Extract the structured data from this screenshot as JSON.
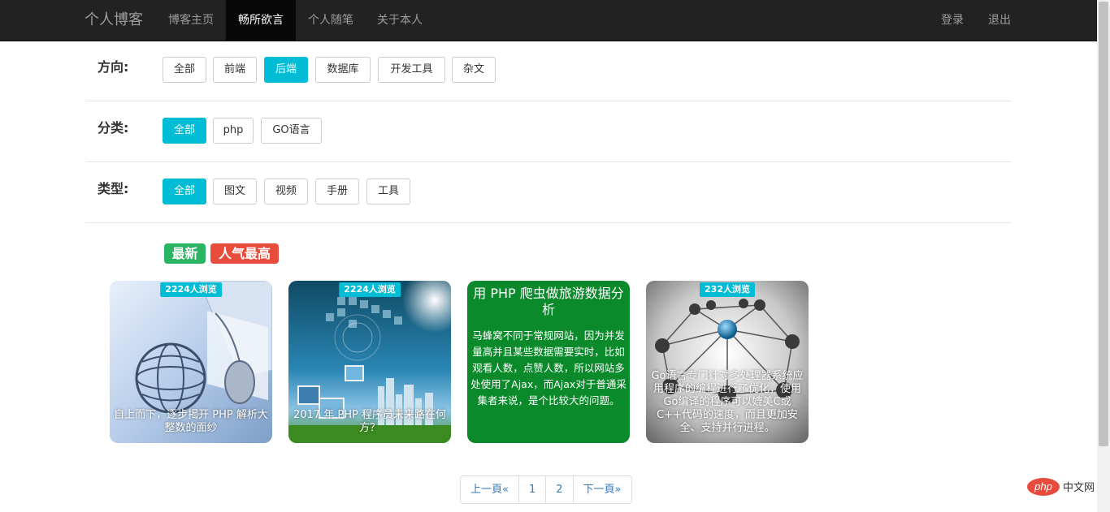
{
  "navbar": {
    "brand": "个人博客",
    "items": [
      "博客主页",
      "畅所欲言",
      "个人随笔",
      "关于本人"
    ],
    "active": "畅所欲言",
    "right": [
      "登录",
      "退出"
    ]
  },
  "filters": {
    "direction": {
      "label": "方向:",
      "options": [
        "全部",
        "前端",
        "后端",
        "数据库",
        "开发工具",
        "杂文"
      ],
      "selected": "后端"
    },
    "category": {
      "label": "分类:",
      "options": [
        "全部",
        "php",
        "GO语言"
      ],
      "selected": "全部"
    },
    "type": {
      "label": "类型:",
      "options": [
        "全部",
        "图文",
        "视频",
        "手册",
        "工具"
      ],
      "selected": "全部"
    }
  },
  "sort": {
    "latest": "最新",
    "popular": "人气最高",
    "latest_color": "#28b463",
    "popular_color": "#e74c3c"
  },
  "cards": [
    {
      "views": "2224人浏览",
      "caption": "自上而下，逐步揭开 PHP 解析大整数的面纱",
      "image": "laptop-globe-mouse-image"
    },
    {
      "views": "2224人浏览",
      "caption": "2017 年 PHP 程序员未来路在何方？",
      "image": "city-screens-image"
    },
    {
      "title": "用 PHP 爬虫做旅游数据分析",
      "body": "马蜂窝不同于常规网站，因为并发量高并且某些数据需要实时，比如观看人数，点赞人数，所以网站多处使用了Ajax，而Ajax对于普通采集者来说，是个比较大的问题。",
      "color": "#0a8a2a"
    },
    {
      "views": "232人浏览",
      "caption": "Go语言专门针对多处理器系统应用程序的编程进行了优化，使用Go编译的程序可以媲美C或C++代码的速度，而且更加安全、支持并行进程。",
      "image": "network-spheres-image"
    }
  ],
  "pagination": [
    "上一頁«",
    "1",
    "2",
    "下一頁»"
  ],
  "watermark": {
    "logo": "php",
    "text": "中文网"
  },
  "colors": {
    "accent": "#00bcd4",
    "navbar": "#222222",
    "link": "#337ab7"
  }
}
